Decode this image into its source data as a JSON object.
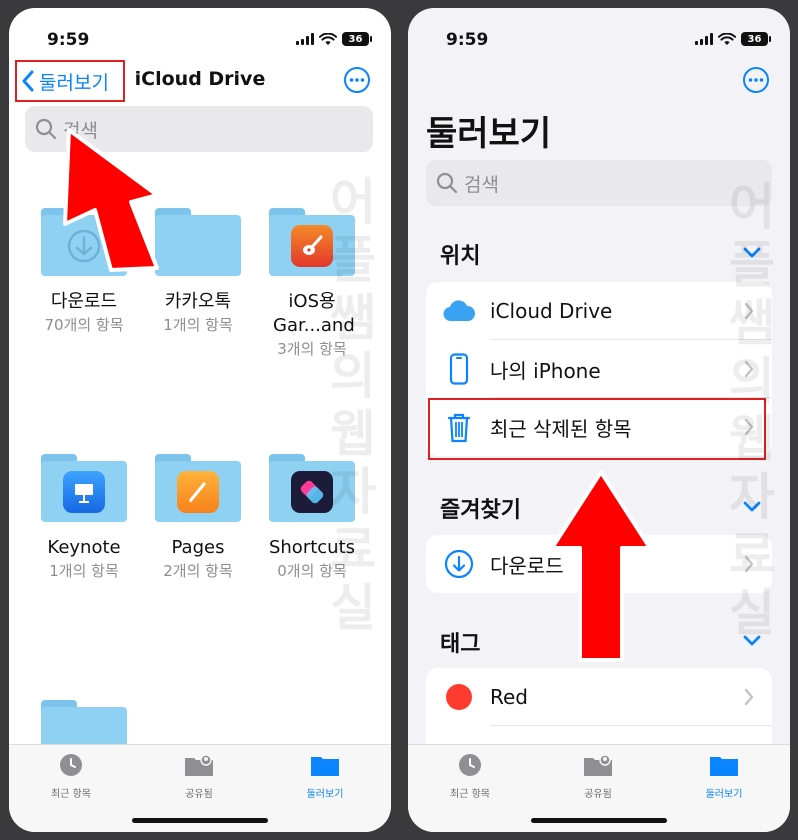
{
  "left": {
    "status": {
      "time": "9:59",
      "battery": "36"
    },
    "nav": {
      "back_label": "둘러보기",
      "title": "iCloud Drive"
    },
    "search": {
      "placeholder": "검색"
    },
    "items": [
      {
        "name": "다운로드",
        "count": "70개의 항목",
        "icon": "download-icon"
      },
      {
        "name": "카카오톡",
        "count": "1개의 항목",
        "icon": ""
      },
      {
        "name": "iOS용 Gar...and",
        "count": "3개의 항목",
        "icon": "guitar-icon"
      },
      {
        "name": "Keynote",
        "count": "1개의 항목",
        "icon": "keynote-icon"
      },
      {
        "name": "Pages",
        "count": "2개의 항목",
        "icon": "pen-icon"
      },
      {
        "name": "Shortcuts",
        "count": "0개의 항목",
        "icon": "shortcuts-icon"
      }
    ],
    "tabs": [
      {
        "label": "최근 항목",
        "icon": "clock-icon"
      },
      {
        "label": "공유됨",
        "icon": "shared-folder-icon"
      },
      {
        "label": "둘러보기",
        "icon": "folder-icon",
        "active": true
      }
    ]
  },
  "right": {
    "status": {
      "time": "9:59",
      "battery": "36"
    },
    "title": "둘러보기",
    "search": {
      "placeholder": "검색"
    },
    "sections": {
      "locations": {
        "header": "위치",
        "items": [
          {
            "label": "iCloud Drive",
            "icon": "icloud-icon"
          },
          {
            "label": "나의 iPhone",
            "icon": "iphone-icon"
          },
          {
            "label": "최근 삭제된 항목",
            "icon": "trash-icon"
          }
        ]
      },
      "favorites": {
        "header": "즐겨찾기",
        "items": [
          {
            "label": "다운로드",
            "icon": "download-circle-icon"
          }
        ]
      },
      "tags": {
        "header": "태그",
        "items": [
          {
            "label": "Red",
            "color": "#ff3b30"
          }
        ]
      }
    },
    "tabs": [
      {
        "label": "최근 항목",
        "icon": "clock-icon"
      },
      {
        "label": "공유됨",
        "icon": "shared-folder-icon"
      },
      {
        "label": "둘러보기",
        "icon": "folder-icon",
        "active": true
      }
    ]
  },
  "colors": {
    "accent": "#0a84ff",
    "highlight": "#e02020",
    "arrow": "#ff0000",
    "folder": "#8fd1f3"
  }
}
